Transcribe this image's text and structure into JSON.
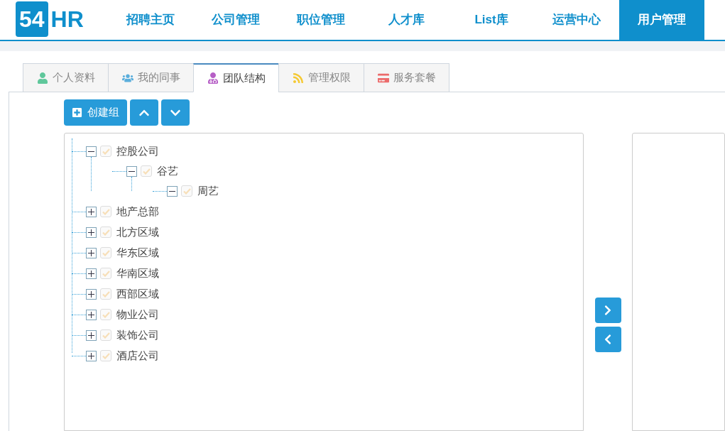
{
  "logo": {
    "number": "54",
    "letters": "HR"
  },
  "nav": [
    {
      "label": "招聘主页",
      "selected": false
    },
    {
      "label": "公司管理",
      "selected": false
    },
    {
      "label": "职位管理",
      "selected": false
    },
    {
      "label": "人才库",
      "selected": false
    },
    {
      "label": "List库",
      "selected": false
    },
    {
      "label": "运营中心",
      "selected": false
    },
    {
      "label": "用户管理",
      "selected": true
    }
  ],
  "tabs": [
    {
      "label": "个人资料",
      "kind": "person",
      "selected": false
    },
    {
      "label": "我的同事",
      "kind": "people",
      "selected": false
    },
    {
      "label": "团队结构",
      "kind": "team",
      "selected": true
    },
    {
      "label": "管理权限",
      "kind": "rss",
      "selected": false
    },
    {
      "label": "服务套餐",
      "kind": "card",
      "selected": false
    }
  ],
  "toolbar": {
    "create_label": "创建组"
  },
  "tree": [
    {
      "label": "控股公司",
      "checked": true,
      "expanded": true,
      "children": [
        {
          "label": "谷艺",
          "checked": true,
          "expanded": true,
          "children": [
            {
              "label": "周艺",
              "checked": true,
              "expanded": true
            }
          ]
        }
      ]
    },
    {
      "label": "地产总部",
      "checked": true,
      "expanded": false
    },
    {
      "label": "北方区域",
      "checked": true,
      "expanded": false
    },
    {
      "label": "华东区域",
      "checked": true,
      "expanded": false
    },
    {
      "label": "华南区域",
      "checked": true,
      "expanded": false
    },
    {
      "label": "西部区域",
      "checked": true,
      "expanded": false
    },
    {
      "label": "物业公司",
      "checked": true,
      "expanded": false
    },
    {
      "label": "装饰公司",
      "checked": true,
      "expanded": false
    },
    {
      "label": "酒店公司",
      "checked": true,
      "expanded": false
    }
  ]
}
